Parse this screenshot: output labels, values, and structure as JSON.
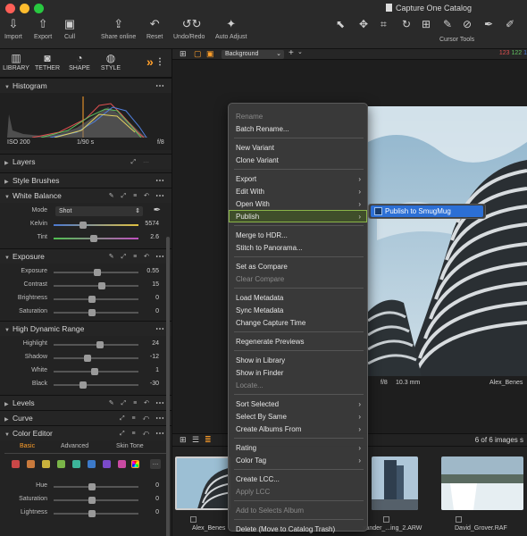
{
  "window": {
    "title": "Capture One Catalog"
  },
  "toolbar": {
    "buttons": [
      {
        "label": "Import",
        "icon": "import-icon"
      },
      {
        "label": "Export",
        "icon": "export-icon"
      },
      {
        "label": "Cull",
        "icon": "cull-icon"
      },
      {
        "label": "Share online",
        "icon": "share-icon"
      },
      {
        "label": "Reset",
        "icon": "reset-icon"
      },
      {
        "label": "Undo/Redo",
        "icon": "undo-redo-icon"
      },
      {
        "label": "Auto Adjust",
        "icon": "wand-icon"
      }
    ],
    "cursor_tools_label": "Cursor Tools"
  },
  "tool_tabs": [
    {
      "label": "LIBRARY",
      "icon": "library-icon"
    },
    {
      "label": "TETHER",
      "icon": "camera-icon"
    },
    {
      "label": "SHAPE",
      "icon": "shape-icon"
    },
    {
      "label": "STYLE",
      "icon": "style-icon"
    }
  ],
  "histogram": {
    "title": "Histogram",
    "iso": "ISO 200",
    "shutter": "1/90 s",
    "aperture": "f/8"
  },
  "sections": {
    "layers": "Layers",
    "style_brushes": "Style Brushes",
    "white_balance": "White Balance",
    "exposure": "Exposure",
    "hdr": "High Dynamic Range",
    "levels": "Levels",
    "curve": "Curve",
    "color_editor": "Color Editor"
  },
  "white_balance": {
    "mode_label": "Mode",
    "mode_value": "Shot",
    "kelvin_label": "Kelvin",
    "kelvin_value": "5574",
    "kelvin_level": 0.35,
    "tint_label": "Tint",
    "tint_value": "2.6",
    "tint_level": 0.47
  },
  "exposure": {
    "rows": [
      {
        "label": "Exposure",
        "value": "0.55",
        "level": 0.52
      },
      {
        "label": "Contrast",
        "value": "15",
        "level": 0.57
      },
      {
        "label": "Brightness",
        "value": "0",
        "level": 0.45
      },
      {
        "label": "Saturation",
        "value": "0",
        "level": 0.45
      }
    ]
  },
  "hdr": {
    "rows": [
      {
        "label": "Highlight",
        "value": "24",
        "level": 0.55
      },
      {
        "label": "Shadow",
        "value": "-12",
        "level": 0.4
      },
      {
        "label": "White",
        "value": "1",
        "level": 0.48
      },
      {
        "label": "Black",
        "value": "-30",
        "level": 0.35
      }
    ]
  },
  "color_editor": {
    "tabs": [
      "Basic",
      "Advanced",
      "Skin Tone"
    ],
    "swatch_colors": [
      "#c94747",
      "#c97a3c",
      "#c9b23c",
      "#7ab548",
      "#3cb59a",
      "#3c7ac9",
      "#7a4ac9",
      "#c94aa3"
    ],
    "rows": [
      {
        "label": "Hue",
        "value": "0",
        "level": 0.45
      },
      {
        "label": "Saturation",
        "value": "0",
        "level": 0.45
      },
      {
        "label": "Lightness",
        "value": "0",
        "level": 0.45
      }
    ]
  },
  "viewer": {
    "background_label": "Background",
    "readout": [
      "123",
      "122",
      "1"
    ],
    "readout_colors": [
      "#e05050",
      "#60c060",
      "#5080e0"
    ],
    "caption_aperture": "f/8",
    "caption_focal": "10.3 mm",
    "caption_name": "Alex_Benes"
  },
  "browser": {
    "count": "6 of 6 images s",
    "thumbs": [
      {
        "name": "Alex_Benes"
      },
      {
        "name": "xander_...ing_2.ARW"
      },
      {
        "name": "David_Grover.RAF"
      }
    ]
  },
  "context_menu": {
    "items": [
      {
        "label": "Rename",
        "disabled": true
      },
      {
        "label": "Batch Rename...",
        "disabled": false
      },
      {
        "label": "New Variant",
        "disabled": false
      },
      {
        "label": "Clone Variant",
        "disabled": false
      },
      {
        "label": "Export",
        "disabled": false,
        "submenu": true
      },
      {
        "label": "Edit With",
        "disabled": false,
        "submenu": true
      },
      {
        "label": "Open With",
        "disabled": false,
        "submenu": true
      },
      {
        "label": "Publish",
        "disabled": false,
        "submenu": true,
        "highlighted": true
      },
      {
        "label": "Merge to HDR...",
        "disabled": false
      },
      {
        "label": "Stitch to Panorama...",
        "disabled": false
      },
      {
        "label": "Set as Compare",
        "disabled": false
      },
      {
        "label": "Clear Compare",
        "disabled": true
      },
      {
        "label": "Load Metadata",
        "disabled": false
      },
      {
        "label": "Sync Metadata",
        "disabled": false
      },
      {
        "label": "Change Capture Time",
        "disabled": false
      },
      {
        "label": "Regenerate Previews",
        "disabled": false
      },
      {
        "label": "Show in Library",
        "disabled": false
      },
      {
        "label": "Show in Finder",
        "disabled": false
      },
      {
        "label": "Locate...",
        "disabled": true
      },
      {
        "label": "Sort Selected",
        "disabled": false,
        "submenu": true
      },
      {
        "label": "Select By Same",
        "disabled": false,
        "submenu": true
      },
      {
        "label": "Create Albums From",
        "disabled": false,
        "submenu": true
      },
      {
        "label": "Rating",
        "disabled": false,
        "submenu": true
      },
      {
        "label": "Color Tag",
        "disabled": false,
        "submenu": true
      },
      {
        "label": "Create LCC...",
        "disabled": false
      },
      {
        "label": "Apply LCC",
        "disabled": true
      },
      {
        "label": "Add to Selects Album",
        "disabled": true
      },
      {
        "label": "Delete (Move to Catalog Trash)",
        "disabled": false
      }
    ],
    "submenu_item": "Publish to SmugMug"
  }
}
